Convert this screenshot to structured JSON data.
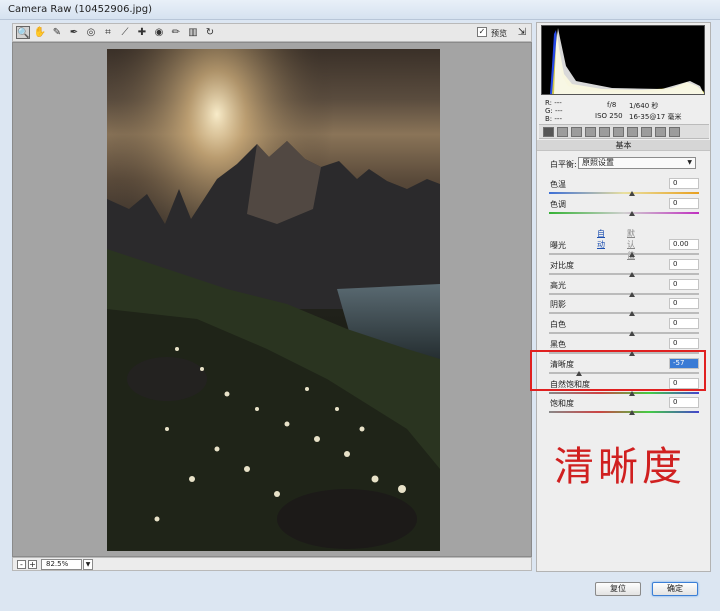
{
  "window": {
    "title": "Camera Raw (10452906.jpg)"
  },
  "toolbar": {
    "tools": [
      {
        "icon": "zoom-icon",
        "glyph": "🔍"
      },
      {
        "icon": "hand-icon",
        "glyph": "✋"
      },
      {
        "icon": "white-balance-icon",
        "glyph": "✎"
      },
      {
        "icon": "color-sampler-icon",
        "glyph": "✒"
      },
      {
        "icon": "target-adjust-icon",
        "glyph": "◎"
      },
      {
        "icon": "crop-icon",
        "glyph": "⌗"
      },
      {
        "icon": "straighten-icon",
        "glyph": "⟋"
      },
      {
        "icon": "retouch-icon",
        "glyph": "✚"
      },
      {
        "icon": "redeye-icon",
        "glyph": "◉"
      },
      {
        "icon": "brush-icon",
        "glyph": "✏"
      },
      {
        "icon": "gradient-icon",
        "glyph": "▥"
      },
      {
        "icon": "rotate-icon",
        "glyph": "↻"
      }
    ],
    "preview_label": "预览",
    "preview_checked": true,
    "preview_mark": "✓",
    "fullscreen_glyph": "⇲"
  },
  "status": {
    "zoom_value": "82.5%",
    "minus": "-",
    "plus": "+",
    "dropdown": "▼"
  },
  "readouts": {
    "r": "R:  ---",
    "g": "G:  ---",
    "b": "B:  ---",
    "aperture": "f/8",
    "shutter": "1/640 秒",
    "iso": "ISO 250",
    "lens": "16-35@17 毫米"
  },
  "section_title": "基本",
  "white_balance": {
    "label": "白平衡:",
    "value": "原照设置",
    "arrow": "▼"
  },
  "sliders_top": [
    {
      "label": "色温",
      "value": "0",
      "track": "temp",
      "pos": 0.55
    },
    {
      "label": "色调",
      "value": "0",
      "track": "tint",
      "pos": 0.55
    }
  ],
  "links": {
    "auto": "自动",
    "default": "默认值"
  },
  "sliders_main": [
    {
      "label": "曝光",
      "value": "0.00",
      "pos": 0.55
    },
    {
      "label": "对比度",
      "value": "0",
      "pos": 0.55
    },
    {
      "label": "高光",
      "value": "0",
      "pos": 0.55
    },
    {
      "label": "阴影",
      "value": "0",
      "pos": 0.55
    },
    {
      "label": "白色",
      "value": "0",
      "pos": 0.55
    },
    {
      "label": "黑色",
      "value": "0",
      "pos": 0.55
    },
    {
      "label": "清晰度",
      "value": "-57",
      "pos": 0.2,
      "highlight": true
    },
    {
      "label": "自然饱和度",
      "value": "0",
      "pos": 0.55,
      "track": "sat"
    },
    {
      "label": "饱和度",
      "value": "0",
      "pos": 0.55,
      "track": "sat"
    }
  ],
  "callout": {
    "text": "清晰度"
  },
  "buttons": {
    "reset": "复位",
    "ok": "确定"
  },
  "colors": {
    "callout_red": "#d02020",
    "highlight_blue": "#3a7bd5"
  }
}
